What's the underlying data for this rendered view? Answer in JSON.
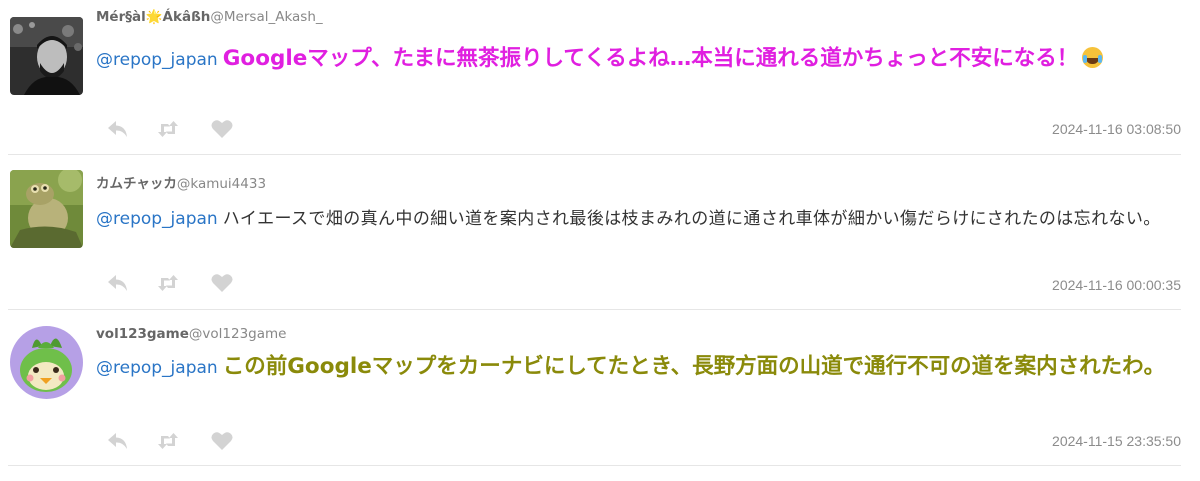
{
  "tweets": [
    {
      "display_name": "Mér§àl🌟Ákâßh",
      "handle": "@Mersal_Akash_",
      "mention": "@repop_japan",
      "text": "Googleマップ、たまに無茶振りしてくるよね…本当に通れる道かちょっと不安になる！",
      "emoji": "face-with-tears-of-joy",
      "timestamp": "2024-11-16 03:08:50",
      "text_color": "#e01fe0"
    },
    {
      "display_name": "カムチャッカ",
      "handle": "@kamui4433",
      "mention": "@repop_japan",
      "text": "ハイエースで畑の真ん中の細い道を案内され最後は枝まみれの道に通され車体が細かい傷だらけにされたのは忘れない。",
      "timestamp": "2024-11-16 00:00:35",
      "text_color": "#333333"
    },
    {
      "display_name": "vol123game",
      "handle": "@vol123game",
      "mention": "@repop_japan",
      "text": "この前Googleマップをカーナビにしてたとき、長野方面の山道で通行不可の道を案内されたわ。",
      "timestamp": "2024-11-15 23:35:50",
      "text_color": "#8a8a0a"
    }
  ],
  "icons": {
    "reply": "reply-icon",
    "retweet": "retweet-icon",
    "like": "heart-icon"
  },
  "colors": {
    "mention": "#2a75c6",
    "action_icon": "#d3d3d3",
    "separator": "#e6e6e6",
    "timestamp": "#8c8c8c"
  }
}
